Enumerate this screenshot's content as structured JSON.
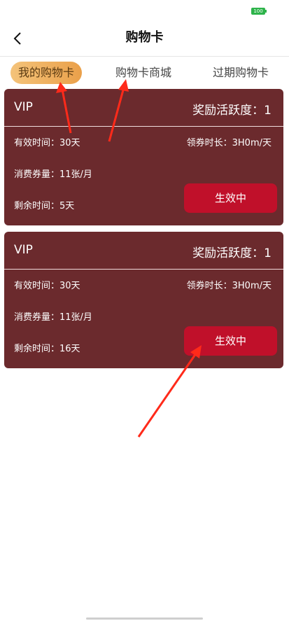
{
  "status_bar": {
    "battery_label": "100",
    "battery_color": "#2db34a"
  },
  "header": {
    "title": "购物卡",
    "back_icon": "chevron-left-icon"
  },
  "tabs": [
    {
      "label": "我的购物卡",
      "active": true
    },
    {
      "label": "购物卡商城",
      "active": false
    },
    {
      "label": "过期购物卡",
      "active": false
    }
  ],
  "cards": [
    {
      "level": "VIP",
      "activity": "奖励活跃度：1",
      "valid_time": "有效时间：30天",
      "claim_duration": "领券时长：3H0m/天",
      "consumption": "消费券量：11张/月",
      "remaining": "剩余时间：5天",
      "status_button": "生效中"
    },
    {
      "level": "VIP",
      "activity": "奖励活跃度：1",
      "valid_time": "有效时间：30天",
      "claim_duration": "领券时长：3H0m/天",
      "consumption": "消费券量：11张/月",
      "remaining": "剩余时间：16天",
      "status_button": "生效中"
    }
  ],
  "colors": {
    "card_bg": "#6b2a2d",
    "button_bg": "#c0102a",
    "tab_active_bg": "#eaa04a",
    "annotation_arrow": "#ff2a1a"
  }
}
